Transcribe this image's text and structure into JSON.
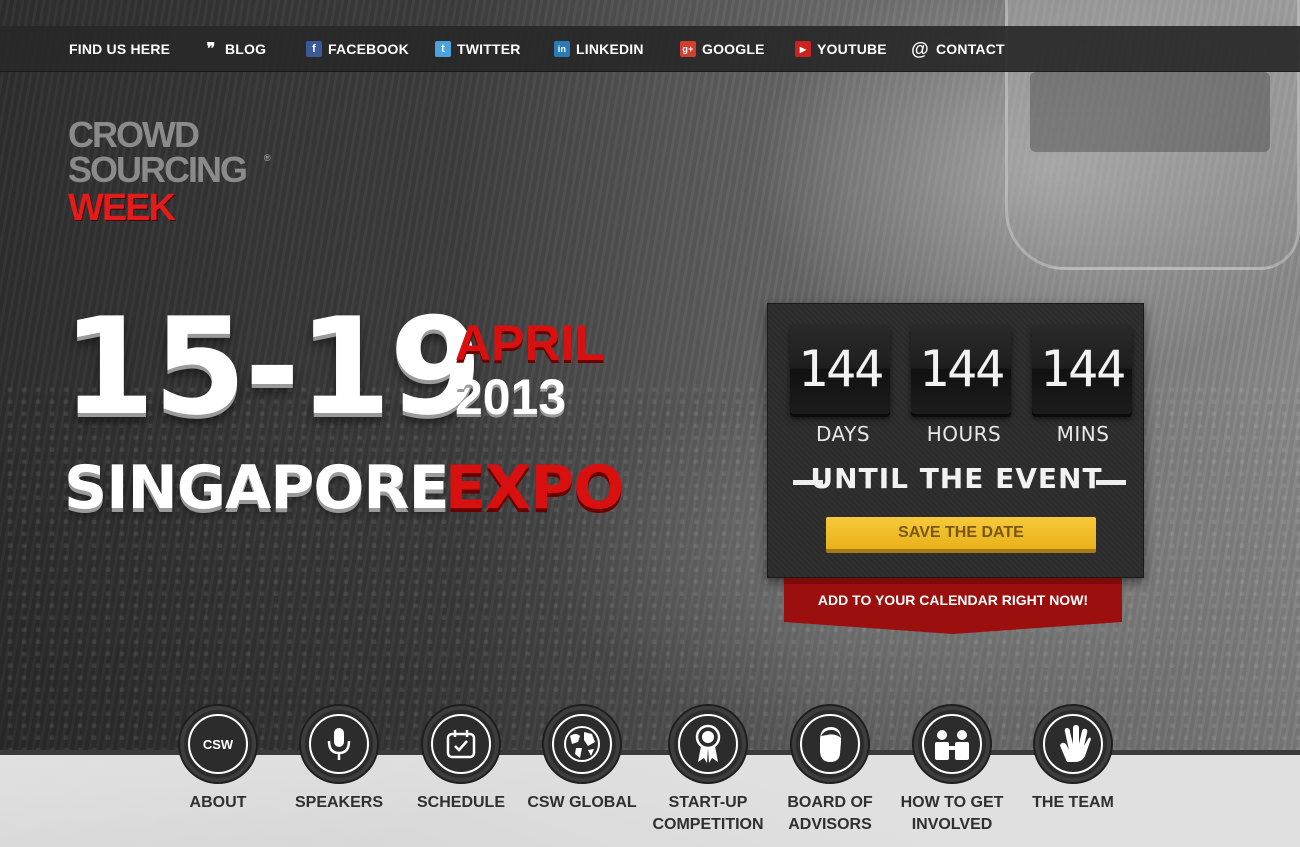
{
  "nav": {
    "find_us": "FIND US HERE",
    "items": [
      {
        "label": "BLOG",
        "icon": "blog-icon"
      },
      {
        "label": "FACEBOOK",
        "icon": "facebook-icon"
      },
      {
        "label": "TWITTER",
        "icon": "twitter-icon"
      },
      {
        "label": "LINKEDIN",
        "icon": "linkedin-icon"
      },
      {
        "label": "GOOGLE",
        "icon": "google-plus-icon"
      },
      {
        "label": "YOUTUBE",
        "icon": "youtube-icon"
      },
      {
        "label": "CONTACT",
        "icon": "at-icon"
      }
    ]
  },
  "logo": {
    "line1": "CROWD",
    "line2": "SOURCING",
    "line3": "WEEK",
    "registered": "®",
    "brand_red": "#e31b1b",
    "brand_gray": "#8b8b8b"
  },
  "event": {
    "dates": "15-19",
    "month": "APRIL",
    "year": "2013",
    "venue_white": "SINGAPORE",
    "venue_red": "EXPO"
  },
  "countdown": {
    "units": [
      {
        "value": "144",
        "label": "DAYS"
      },
      {
        "value": "144",
        "label": "HOURS"
      },
      {
        "value": "144",
        "label": "MINS"
      }
    ],
    "until": "UNTIL THE EVENT",
    "save_button": "SAVE THE DATE",
    "calendar_cta": "ADD TO YOUR CALENDAR RIGHT NOW!",
    "accent_yellow": "#f2c12e",
    "accent_red": "#9b0f0f"
  },
  "features": [
    {
      "label": "ABOUT",
      "icon": "csw-speech-bubble-icon",
      "glyph": "CSW"
    },
    {
      "label": "SPEAKERS",
      "icon": "microphone-icon",
      "glyph": "🎙"
    },
    {
      "label": "SCHEDULE",
      "icon": "calendar-check-icon",
      "glyph": "✓"
    },
    {
      "label": "CSW GLOBAL",
      "icon": "globe-icon",
      "glyph": "🌐"
    },
    {
      "label": "START-UP\nCOMPETITION",
      "icon": "award-ribbon-icon",
      "glyph": "✪"
    },
    {
      "label": "BOARD OF\nADVISORS",
      "icon": "head-profile-icon",
      "glyph": "☻"
    },
    {
      "label": "HOW TO GET\nINVOLVED",
      "icon": "people-group-icon",
      "glyph": "👥"
    },
    {
      "label": "THE TEAM",
      "icon": "hand-wave-icon",
      "glyph": "✋"
    }
  ]
}
